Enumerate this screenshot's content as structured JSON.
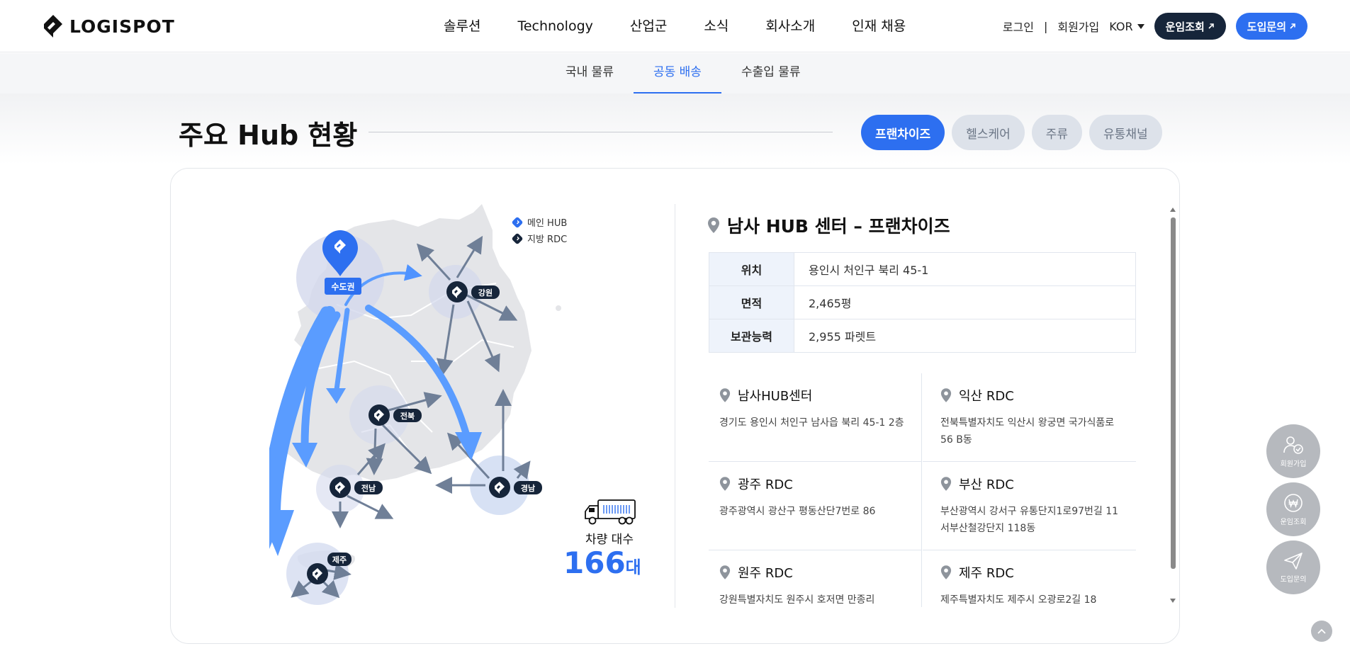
{
  "header": {
    "logo_text": "LOGISPOT",
    "nav": [
      "솔루션",
      "Technology",
      "산업군",
      "소식",
      "회사소개",
      "인재 채용"
    ],
    "login": "로그인",
    "separator": "|",
    "signup": "회원가입",
    "language": "KOR",
    "track_button": "운임조회",
    "inquiry_button": "도입문의"
  },
  "subnav": {
    "tabs": [
      "국내 물류",
      "공동 배송",
      "수출입 물류"
    ],
    "active_index": 1
  },
  "section": {
    "title": "주요 Hub 현황",
    "filters": [
      "프랜차이즈",
      "헬스케어",
      "주류",
      "유통채널"
    ],
    "active_filter": 0
  },
  "map": {
    "legend": {
      "main_hub": "메인 HUB",
      "regional_rdc": "지방 RDC"
    },
    "hubs": {
      "capital": "수도권",
      "gangwon": "강원",
      "jeonbuk": "전북",
      "jeonnam": "전남",
      "gyeongnam": "경남",
      "jeju": "제주"
    },
    "vehicle_label": "차량 대수",
    "vehicle_count": "166",
    "vehicle_unit": "대"
  },
  "detail": {
    "title": "남사 HUB 센터 – 프랜차이즈",
    "rows": [
      {
        "key": "위치",
        "value": "용인시 처인구 북리 45-1"
      },
      {
        "key": "면적",
        "value": "2,465평"
      },
      {
        "key": "보관능력",
        "value": "2,955 파렛트"
      }
    ],
    "centers": [
      {
        "name": "남사HUB센터",
        "address": "경기도 용인시 처인구 남사읍 북리 45-1 2층"
      },
      {
        "name": "익산 RDC",
        "address": "전북특별자치도 익산시 왕궁면 국가식품로 56 B동"
      },
      {
        "name": "광주 RDC",
        "address": "광주광역시 광산구 평동산단7번로 86"
      },
      {
        "name": "부산 RDC",
        "address": "부산광역시 강서구 유통단지1로97번길 11 서부산철강단지 118동"
      },
      {
        "name": "원주 RDC",
        "address": "강원특별자치도 원주시 호저면 만종리"
      },
      {
        "name": "제주 RDC",
        "address": "제주특별자치도 제주시 오광로2길 18"
      }
    ]
  },
  "floating": {
    "signup": "회원가입",
    "track": "운임조회",
    "inquiry": "도입문의"
  },
  "colors": {
    "brand_blue": "#2d6ff0",
    "navy": "#16253a",
    "map_gray": "#e6e7e9",
    "arrow_blue": "#5a9cff"
  }
}
